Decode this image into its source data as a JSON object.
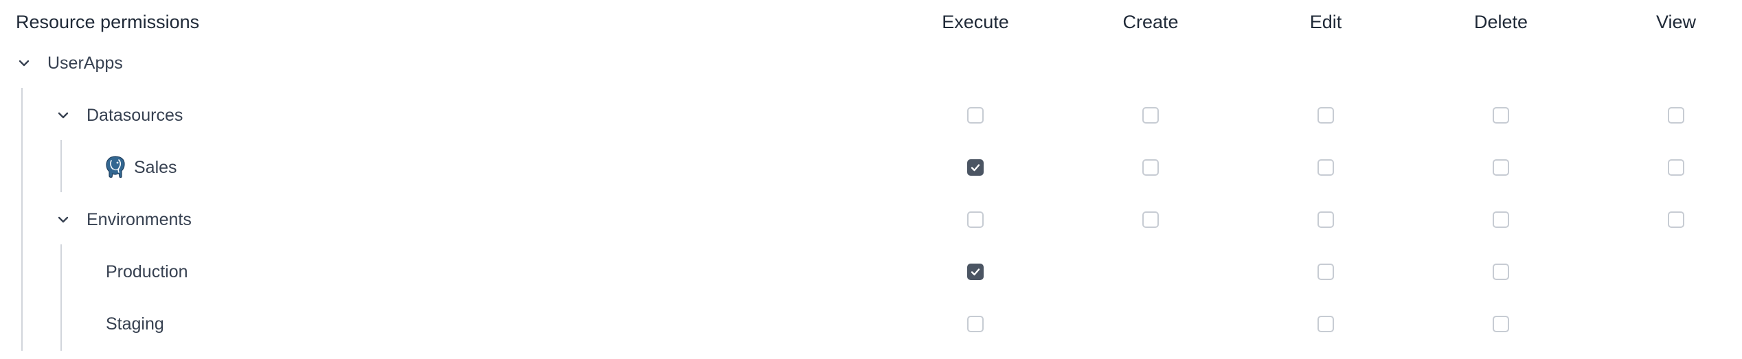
{
  "header": {
    "title": "Resource permissions",
    "columns": [
      "Execute",
      "Create",
      "Edit",
      "Delete",
      "View"
    ]
  },
  "tree": {
    "root": {
      "label": "UserApps",
      "icon": "chevron-down-icon"
    },
    "datasources": {
      "label": "Datasources",
      "icon": "chevron-down-icon",
      "permissions": {
        "execute": false,
        "create": false,
        "edit": false,
        "delete": false,
        "view": false
      },
      "items": [
        {
          "label": "Sales",
          "icon": "postgresql-elephant-icon",
          "permissions": {
            "execute": true,
            "create": false,
            "edit": false,
            "delete": false,
            "view": false
          }
        }
      ]
    },
    "environments": {
      "label": "Environments",
      "icon": "chevron-down-icon",
      "permissions": {
        "execute": false,
        "create": false,
        "edit": false,
        "delete": false,
        "view": false
      },
      "items": [
        {
          "label": "Production",
          "permissions": {
            "execute": true,
            "edit": false,
            "delete": false
          }
        },
        {
          "label": "Staging",
          "permissions": {
            "execute": false,
            "edit": false,
            "delete": false
          }
        }
      ]
    }
  },
  "colors": {
    "checked_fill": "#4b5563",
    "checkbox_border": "#c7ccd3",
    "tree_line": "#d1d5db",
    "text": "#1f2937"
  }
}
